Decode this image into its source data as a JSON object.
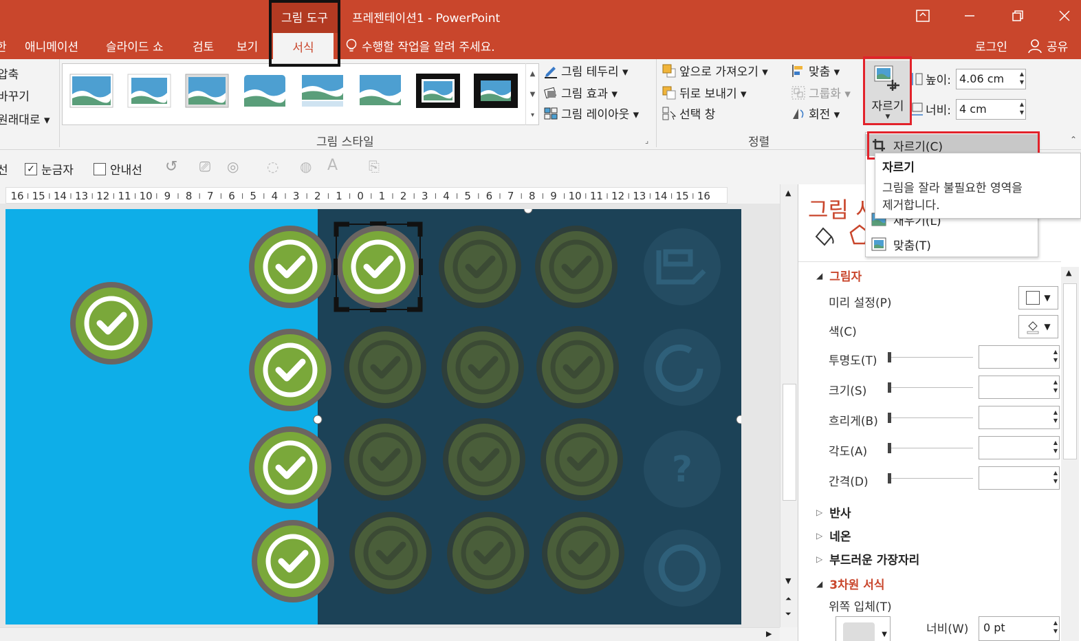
{
  "app": {
    "context_tab_group": "그림 도구",
    "doc_title": "프레젠테이션1 - PowerPoint",
    "window_controls": [
      "ribbon-display-icon",
      "minimize-icon",
      "restore-icon",
      "close-icon"
    ]
  },
  "tabs": {
    "cut_left": "한",
    "items": [
      "애니메이션",
      "슬라이드 쇼",
      "검토",
      "보기"
    ],
    "active": "서식",
    "tell_me": "수행할 작업을 알려 주세요.",
    "login": "로그인",
    "share": "공유"
  },
  "ribbon": {
    "left_cut_items": [
      "압축",
      "바꾸기",
      "원래대로 ▾"
    ],
    "picture_styles_label": "그림 스타일",
    "picture_border": "그림 테두리 ▾",
    "picture_effects": "그림 효과 ▾",
    "picture_layout": "그림 레이아웃 ▾",
    "bring_forward": "앞으로 가져오기 ▾",
    "send_backward": "뒤로 보내기 ▾",
    "selection_pane": "선택 창",
    "align": "맞춤 ▾",
    "group": "그룹화 ▾",
    "rotate": "회전 ▾",
    "arrange_label": "정렬",
    "crop_label": "자르기",
    "height_label": "높이:",
    "height_value": "4.06 cm",
    "width_label": "너비:",
    "width_value": "4 cm"
  },
  "crop_menu": {
    "items": [
      "자르기(C)",
      "채우기(L)",
      "맞춤(T)"
    ],
    "tooltip_title": "자르기",
    "tooltip_desc_1": "그림을 잘라 불필요한 영역을",
    "tooltip_desc_2": "제거합니다."
  },
  "toolbar2": {
    "cut_left": "선",
    "ruler_label": "눈금자",
    "ruler_checked": true,
    "guides_label": "안내선",
    "guides_checked": false
  },
  "ruler": {
    "ticks": [
      "16",
      "15",
      "14",
      "13",
      "12",
      "11",
      "10",
      "9",
      "8",
      "7",
      "6",
      "5",
      "4",
      "3",
      "2",
      "1",
      "0",
      "1",
      "2",
      "3",
      "4",
      "5",
      "6",
      "7",
      "8",
      "9",
      "10",
      "11",
      "12",
      "13",
      "14",
      "15",
      "16"
    ]
  },
  "pane": {
    "title": "그림 서",
    "shadow_section": "그림자",
    "props": [
      "미리 설정(P)",
      "색(C)",
      "투명도(T)",
      "크기(S)",
      "흐리게(B)",
      "각도(A)",
      "간격(D)"
    ],
    "reflection": "반사",
    "glow": "네온",
    "soft_edges": "부드러운 가장자리",
    "three_d_format": "3차원 서식",
    "top_bevel": "위쪽 입체(T)",
    "width_label": "너비(W)",
    "width_value": "0 pt"
  },
  "colors": {
    "accent": "#c9462c",
    "slide_left": "#0eaee8",
    "slide_right": "#1c4257",
    "badge_green": "#7aa83a",
    "badge_ring": "#6b6561",
    "highlight_red": "#e2222a"
  }
}
